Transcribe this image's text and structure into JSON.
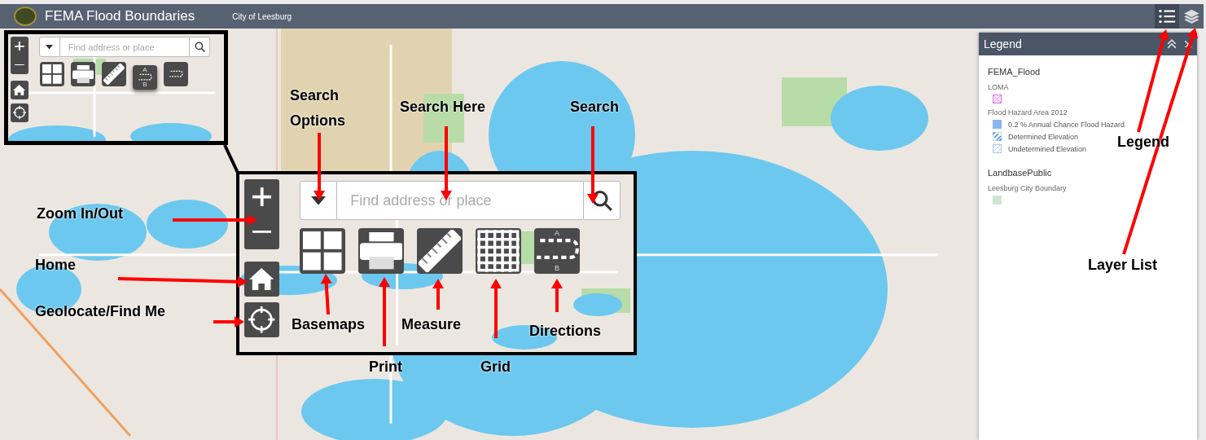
{
  "header": {
    "title": "FEMA Flood Boundaries",
    "subtitle": "City of Leesburg",
    "buttons": [
      {
        "kind": "legend",
        "selected": true
      },
      {
        "kind": "layers",
        "selected": false
      }
    ]
  },
  "inset": {
    "placeholder": "Find address or place",
    "tools": [
      {
        "kind": "basemaps",
        "raised": false
      },
      {
        "kind": "print",
        "raised": false
      },
      {
        "kind": "measure",
        "raised": false
      },
      {
        "kind": "directions",
        "raised": true,
        "from": "A",
        "to": "B"
      },
      {
        "kind": "directions",
        "raised": false
      }
    ]
  },
  "callout": {
    "placeholder": "Find address or place",
    "tools": [
      {
        "kind": "basemaps",
        "raised": false
      },
      {
        "kind": "print",
        "raised": false
      },
      {
        "kind": "measure",
        "raised": false
      },
      {
        "kind": "grid",
        "raised": false
      },
      {
        "kind": "directions",
        "raised": false,
        "from": "A",
        "to": "B"
      }
    ]
  },
  "annotations": [
    {
      "text": "Search Options"
    },
    {
      "text": "Search Here"
    },
    {
      "text": "Search"
    },
    {
      "text": "Zoom In/Out"
    },
    {
      "text": "Home"
    },
    {
      "text": "Geolocate/Find Me"
    },
    {
      "text": "Basemaps"
    },
    {
      "text": "Print"
    },
    {
      "text": "Measure"
    },
    {
      "text": "Grid"
    },
    {
      "text": "Directions"
    },
    {
      "text": "Legend"
    },
    {
      "text": "Layer List"
    }
  ],
  "legend": {
    "title": "Legend",
    "groups": [
      {
        "name": "FEMA_Flood",
        "layers": [
          {
            "name": "LOMA",
            "items": [
              {
                "kind": "loma"
              }
            ]
          },
          {
            "name": "Flood Hazard Area 2012",
            "items": [
              {
                "kind": "solid",
                "label": "0.2 % Annual Chance Flood Hazard"
              },
              {
                "kind": "dashed",
                "label": "Determined Elevation"
              },
              {
                "kind": "hatched",
                "label": "Undetermined Elevation"
              }
            ]
          }
        ]
      },
      {
        "name": "LandbasePublic",
        "layers": [
          {
            "name": "Leesburg City Boundary",
            "items": [
              {
                "kind": "boundary"
              }
            ]
          }
        ]
      }
    ]
  }
}
